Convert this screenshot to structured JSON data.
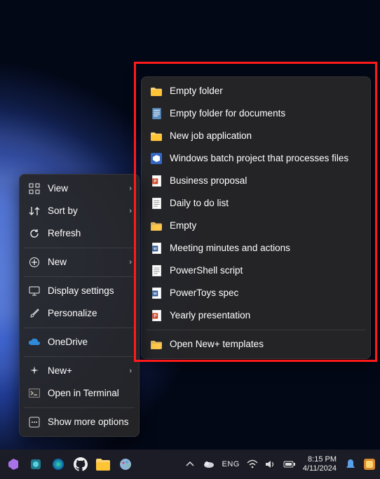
{
  "context_menu": {
    "items": [
      {
        "label": "View",
        "icon": "grid",
        "chev": true
      },
      {
        "label": "Sort by",
        "icon": "sort",
        "chev": true
      },
      {
        "label": "Refresh",
        "icon": "refresh"
      },
      {
        "sep": true
      },
      {
        "label": "New",
        "icon": "plus",
        "chev": true
      },
      {
        "sep": true
      },
      {
        "label": "Display settings",
        "icon": "monitor"
      },
      {
        "label": "Personalize",
        "icon": "brush"
      },
      {
        "sep": true
      },
      {
        "label": "OneDrive",
        "icon": "cloud"
      },
      {
        "sep": true
      },
      {
        "label": "New+",
        "icon": "sparkle",
        "chev": true
      },
      {
        "label": "Open in Terminal",
        "icon": "terminal"
      },
      {
        "sep": true
      },
      {
        "label": "Show more options",
        "icon": "more"
      }
    ]
  },
  "newplus_menu": {
    "items": [
      {
        "label": "Empty folder",
        "icon": "folder"
      },
      {
        "label": "Empty folder for documents",
        "icon": "doclib"
      },
      {
        "label": "New job application",
        "icon": "folder"
      },
      {
        "label": "Windows batch project that processes files",
        "icon": "vsproj"
      },
      {
        "label": "Business proposal",
        "icon": "pptx"
      },
      {
        "label": "Daily to do list",
        "icon": "txt"
      },
      {
        "label": "Empty",
        "icon": "folder-open"
      },
      {
        "label": "Meeting minutes and actions",
        "icon": "docx"
      },
      {
        "label": "PowerShell script",
        "icon": "txt"
      },
      {
        "label": "PowerToys spec",
        "icon": "docx"
      },
      {
        "label": "Yearly presentation",
        "icon": "pptx"
      },
      {
        "sep": true
      },
      {
        "label": "Open New+ templates",
        "icon": "folder-open"
      }
    ]
  },
  "taskbar": {
    "lang": "ENG",
    "time": "8:15 PM",
    "date": "4/11/2024"
  }
}
